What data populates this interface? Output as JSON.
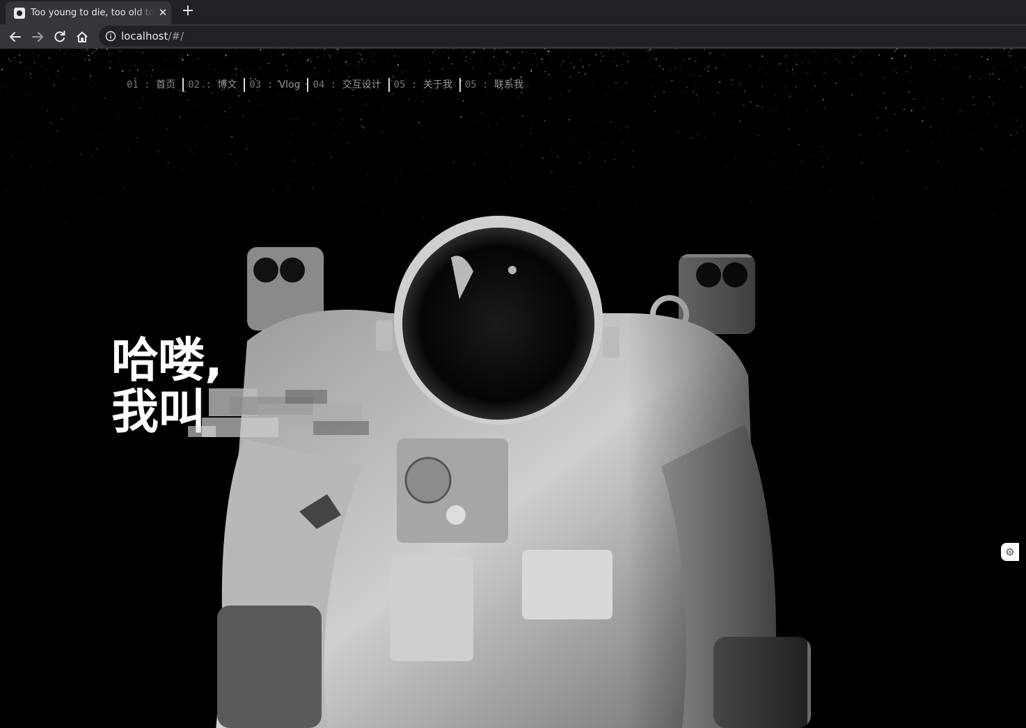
{
  "browser": {
    "tab_title": "Too young to die, too old to live",
    "tab_favicon": "skull-favicon-icon",
    "tab_close_icon": "close-icon",
    "new_tab_icon": "plus-icon",
    "url_host": "localhost",
    "url_path": "/#/"
  },
  "nav": {
    "items": [
      {
        "num": "01",
        "sep": ":",
        "label": "首页"
      },
      {
        "num": "02",
        "sep": ":",
        "label": "博文"
      },
      {
        "num": "03",
        "sep": ":",
        "label": "Vlog"
      },
      {
        "num": "04",
        "sep": ":",
        "label": "交互设计"
      },
      {
        "num": "05",
        "sep": ":",
        "label": "关于我"
      },
      {
        "num": "05",
        "sep": ":",
        "label": "联系我"
      }
    ]
  },
  "hero": {
    "line1": "哈喽,",
    "line2": "我叫"
  },
  "widget": {
    "icon": "settings-gear-icon"
  },
  "colors": {
    "tabbar_bg": "#202124",
    "toolbar_bg": "#35363a",
    "page_bg": "#000000",
    "hero_text": "#ffffff",
    "nav_text": "#777777"
  }
}
